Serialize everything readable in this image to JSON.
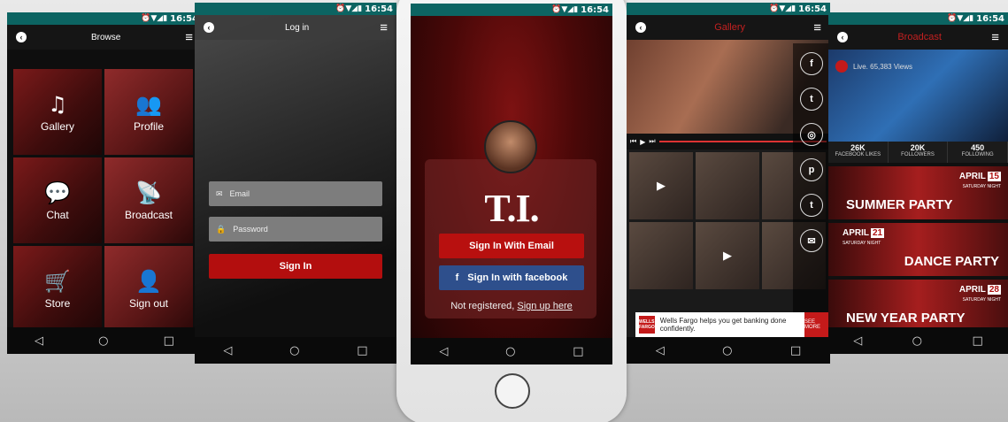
{
  "status": {
    "time": "16:54"
  },
  "nav": {
    "back": "◁",
    "home": "○",
    "recent": "□"
  },
  "browse": {
    "title": "Browse",
    "tiles": [
      {
        "label": "Gallery",
        "icon": "music-note-icon",
        "glyph": "♫"
      },
      {
        "label": "Profile",
        "icon": "users-icon",
        "glyph": "👥"
      },
      {
        "label": "Chat",
        "icon": "chat-icon",
        "glyph": "💬"
      },
      {
        "label": "Broadcast",
        "icon": "broadcast-icon",
        "glyph": "📡"
      },
      {
        "label": "Store",
        "icon": "cart-icon",
        "glyph": "🛒"
      },
      {
        "label": "Sign out",
        "icon": "user-circle-icon",
        "glyph": "👤"
      }
    ]
  },
  "login": {
    "title": "Log in",
    "email_placeholder": "Email",
    "password_placeholder": "Password",
    "signin_label": "Sign In"
  },
  "splash": {
    "logo": "T.I.",
    "email_button": "Sign In With Email",
    "facebook_button": "Sign In with facebook",
    "facebook_glyph": "f",
    "not_registered": "Not registered,",
    "signup_link": "Sign up here"
  },
  "gallery": {
    "title": "Gallery",
    "social": [
      "f",
      "t",
      "◎",
      "p",
      "t",
      "✉"
    ],
    "ad_text": "Wells Fargo helps you get banking done confidently.",
    "ad_logo": "WELLS FARGO",
    "ad_more": "SEE MORE"
  },
  "broadcast": {
    "title": "Broadcast",
    "live_text": "Live. 65,383 Views",
    "stats": [
      {
        "value": "26K",
        "label": "FACEBOOK LIKES"
      },
      {
        "value": "20K",
        "label": "FOLLOWERS"
      },
      {
        "value": "450",
        "label": "FOLLOWING"
      }
    ],
    "events": [
      {
        "month": "APRIL",
        "day": "15",
        "sub": "SATURDAY NIGHT",
        "name": "SUMMER PARTY"
      },
      {
        "month": "APRIL",
        "day": "21",
        "sub": "SATURDAY NIGHT",
        "name": "DANCE PARTY"
      },
      {
        "month": "APRIL",
        "day": "28",
        "sub": "SATURDAY NIGHT",
        "name": "NEW YEAR PARTY"
      }
    ]
  }
}
